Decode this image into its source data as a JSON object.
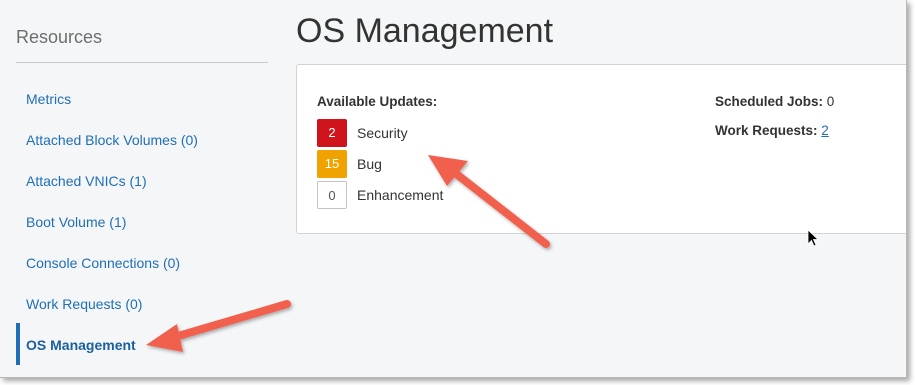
{
  "sidebar": {
    "title": "Resources",
    "items": [
      {
        "label": "Metrics"
      },
      {
        "label": "Attached Block Volumes (0)"
      },
      {
        "label": "Attached VNICs (1)"
      },
      {
        "label": "Boot Volume (1)"
      },
      {
        "label": "Console Connections (0)"
      },
      {
        "label": "Work Requests (0)"
      },
      {
        "label": "OS Management",
        "active": true
      }
    ]
  },
  "main": {
    "title": "OS Management",
    "panel": {
      "updates_title": "Available Updates:",
      "updates": [
        {
          "count": "2",
          "label": "Security",
          "color": "#d0141c"
        },
        {
          "count": "15",
          "label": "Bug",
          "color": "#f0a300"
        },
        {
          "count": "0",
          "label": "Enhancement",
          "color": "#ffffff"
        }
      ],
      "scheduled_jobs_label": "Scheduled Jobs:",
      "scheduled_jobs_value": "0",
      "work_requests_label": "Work Requests:",
      "work_requests_value": "2"
    }
  },
  "annotations": {
    "arrow_color": "#f0614e"
  }
}
